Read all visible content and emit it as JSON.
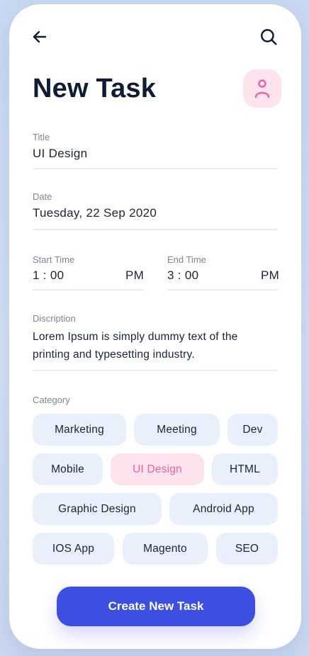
{
  "header": {
    "back_icon": "arrow-left-icon",
    "search_icon": "search-icon",
    "title": "New Task",
    "avatar_icon": "person-icon"
  },
  "form": {
    "title": {
      "label": "Title",
      "value": "UI Design"
    },
    "date": {
      "label": "Date",
      "value": "Tuesday, 22 Sep 2020"
    },
    "start_time": {
      "label": "Start Time",
      "value": "1 : 00",
      "period": "PM"
    },
    "end_time": {
      "label": "End Time",
      "value": "3 : 00",
      "period": "PM"
    },
    "description": {
      "label": "Discription",
      "line1": "Lorem Ipsum is simply dummy text of the",
      "line2": "printing and typesetting industry."
    }
  },
  "category": {
    "label": "Category",
    "chips": [
      {
        "label": "Marketing",
        "selected": false
      },
      {
        "label": "Meeting",
        "selected": false
      },
      {
        "label": "Dev",
        "selected": false
      },
      {
        "label": "Mobile",
        "selected": false
      },
      {
        "label": "UI Design",
        "selected": true
      },
      {
        "label": "HTML",
        "selected": false
      },
      {
        "label": "Graphic Design",
        "selected": false
      },
      {
        "label": "Android App",
        "selected": false
      },
      {
        "label": "IOS App",
        "selected": false
      },
      {
        "label": "Magento",
        "selected": false
      },
      {
        "label": "SEO",
        "selected": false
      }
    ]
  },
  "actions": {
    "create_label": "Create New Task"
  },
  "colors": {
    "primary": "#3d4fe0",
    "accent_pink": "#ec5fa7",
    "accent_pink_bg": "#fde3ee",
    "chip_bg": "#e9f0fc",
    "text_dark": "#101b34"
  }
}
